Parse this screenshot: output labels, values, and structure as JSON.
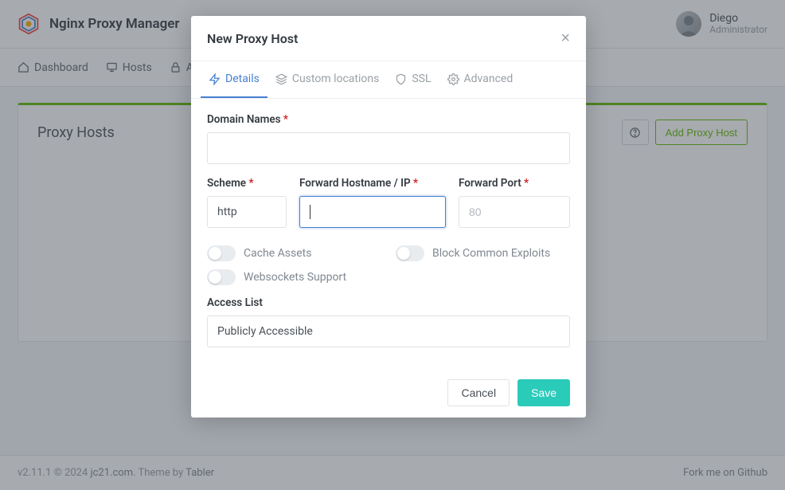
{
  "header": {
    "brand": "Nginx Proxy Manager",
    "user_name": "Diego",
    "user_role": "Administrator"
  },
  "nav": {
    "dashboard": "Dashboard",
    "hosts": "Hosts",
    "access": "Ac"
  },
  "page": {
    "title": "Proxy Hosts",
    "add_button": "Add Proxy Host"
  },
  "footer": {
    "left_prefix": "v2.11.1 © 2024 ",
    "left_link": "jc21.com",
    "left_theme_prefix": ". Theme by ",
    "left_theme_link": "Tabler",
    "right": "Fork me on Github"
  },
  "modal": {
    "title": "New Proxy Host",
    "tabs": {
      "details": "Details",
      "custom": "Custom locations",
      "ssl": "SSL",
      "advanced": "Advanced"
    },
    "labels": {
      "domain_names": "Domain Names",
      "scheme": "Scheme",
      "hostname": "Forward Hostname / IP",
      "port": "Forward Port",
      "cache_assets": "Cache Assets",
      "block_exploits": "Block Common Exploits",
      "websockets": "Websockets Support",
      "access_list": "Access List"
    },
    "values": {
      "scheme": "http",
      "hostname": "",
      "port_placeholder": "80",
      "access_list": "Publicly Accessible",
      "cache_assets": false,
      "block_exploits": false,
      "websockets": false
    },
    "buttons": {
      "cancel": "Cancel",
      "save": "Save"
    }
  }
}
